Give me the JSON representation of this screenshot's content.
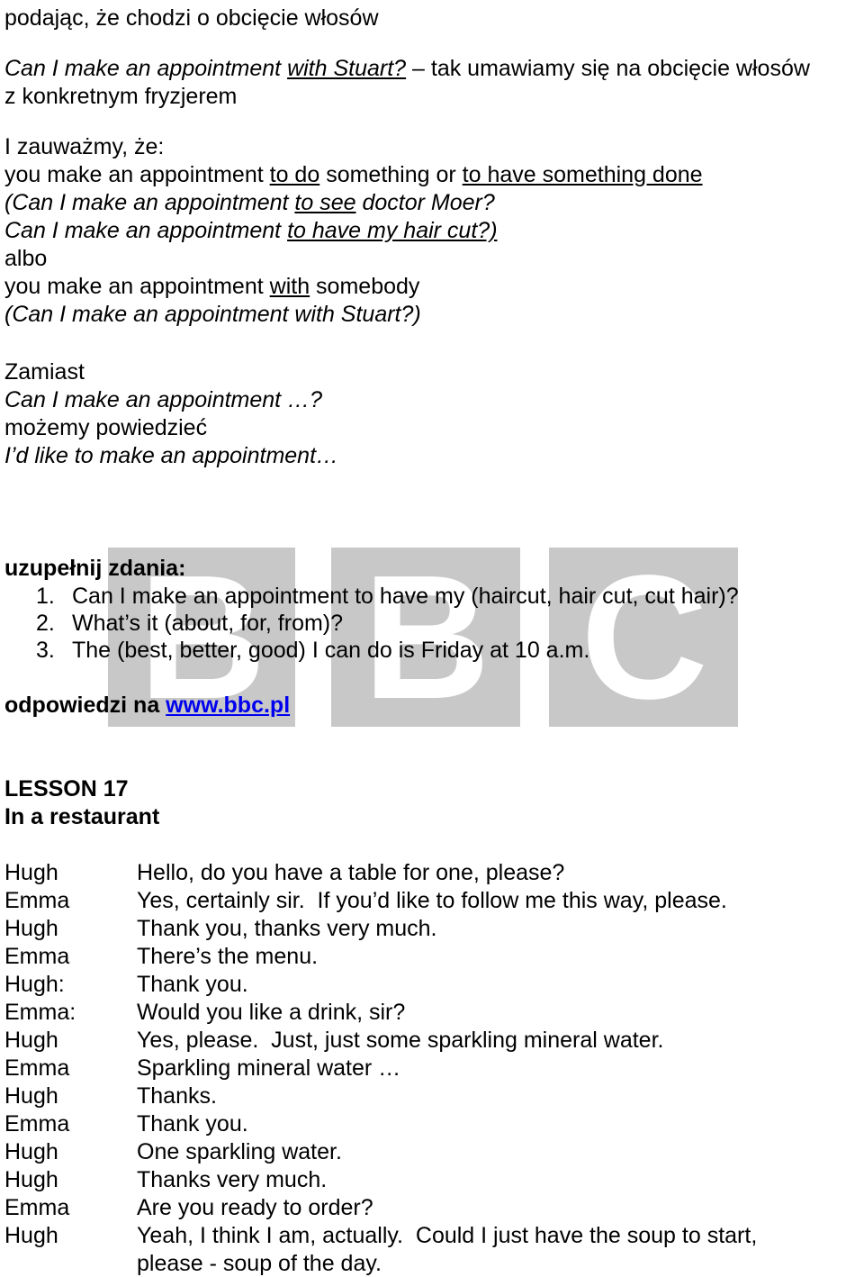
{
  "colors": {
    "text": "#000000",
    "link": "#0000ee",
    "watermark_box": "#c8c8c8",
    "watermark_letter": "#ffffff",
    "page_background": "#ffffff"
  },
  "watermark": {
    "name": "bbc-watermark",
    "letters": [
      "B",
      "B",
      "C"
    ]
  },
  "intro": {
    "line1": "podając, że chodzi o obcięcie włosów",
    "example_italic": "Can I make an appointment ",
    "example_italic_underlined": "with Stuart?",
    "example_tail": " – tak umawiamy się na obcięcie włosów",
    "example_cont": "z konkretnym fryzjerem"
  },
  "notes": {
    "heading": "I zauważmy, że:",
    "rule1_pre": "you make an appointment ",
    "rule1_u1": "to do",
    "rule1_mid": " something or ",
    "rule1_u2": "to have something done",
    "ex1_pre": "(Can I make an appointment ",
    "ex1_u": "to see",
    "ex1_post": " doctor Moer?",
    "ex2_pre": "Can I make an appointment ",
    "ex2_u": "to have my hair cut?)",
    "albo": "albo",
    "rule2_pre": "you make an appointment ",
    "rule2_u": "with",
    "rule2_post": " somebody",
    "ex3": "(Can I make an appointment with Stuart?)"
  },
  "instead": {
    "label": "Zamiast",
    "phrase": "Can I make an appointment …?",
    "can_say": "możemy powiedzieć",
    "better": "I’d like to make an appointment…"
  },
  "exercise": {
    "heading": "uzupełnij zdania:",
    "items": [
      {
        "num": "1.",
        "text": "Can I make an appointment to have my (haircut, hair cut, cut hair)?"
      },
      {
        "num": "2.",
        "text": "What’s it (about, for, from)?"
      },
      {
        "num": "3.",
        "text": "The (best, better, good) I can do is Friday at 10 a.m."
      }
    ],
    "answers_label": "odpowiedzi na ",
    "answers_link": "www.bbc.pl"
  },
  "lesson": {
    "number": "LESSON 17",
    "title": "In a restaurant"
  },
  "dialogue": {
    "lines": [
      {
        "speaker": "Hugh",
        "text": "Hello, do you have a table for one, please?"
      },
      {
        "speaker": "Emma",
        "text": "Yes, certainly sir.  If you’d like to follow me this way, please."
      },
      {
        "speaker": "Hugh",
        "text": "Thank you, thanks very much."
      },
      {
        "speaker": "Emma",
        "text": "There’s the menu."
      },
      {
        "speaker": "Hugh:",
        "text": "Thank you."
      },
      {
        "speaker": "Emma:",
        "text": "Would you like a drink, sir?"
      },
      {
        "speaker": "Hugh",
        "text": "Yes, please.  Just, just some sparkling mineral water."
      },
      {
        "speaker": "Emma",
        "text": "Sparkling mineral water …"
      },
      {
        "speaker": "Hugh",
        "text": "Thanks."
      },
      {
        "speaker": "Emma",
        "text": "Thank you."
      },
      {
        "speaker": "Hugh",
        "text": "One sparkling water."
      },
      {
        "speaker": "Hugh",
        "text": "Thanks very much."
      },
      {
        "speaker": "Emma",
        "text": "Are you ready to order?"
      },
      {
        "speaker": "Hugh",
        "text": "Yeah, I think I am, actually.  Could I just have the soup to start,"
      }
    ],
    "continuation": "please - soup of the day."
  }
}
